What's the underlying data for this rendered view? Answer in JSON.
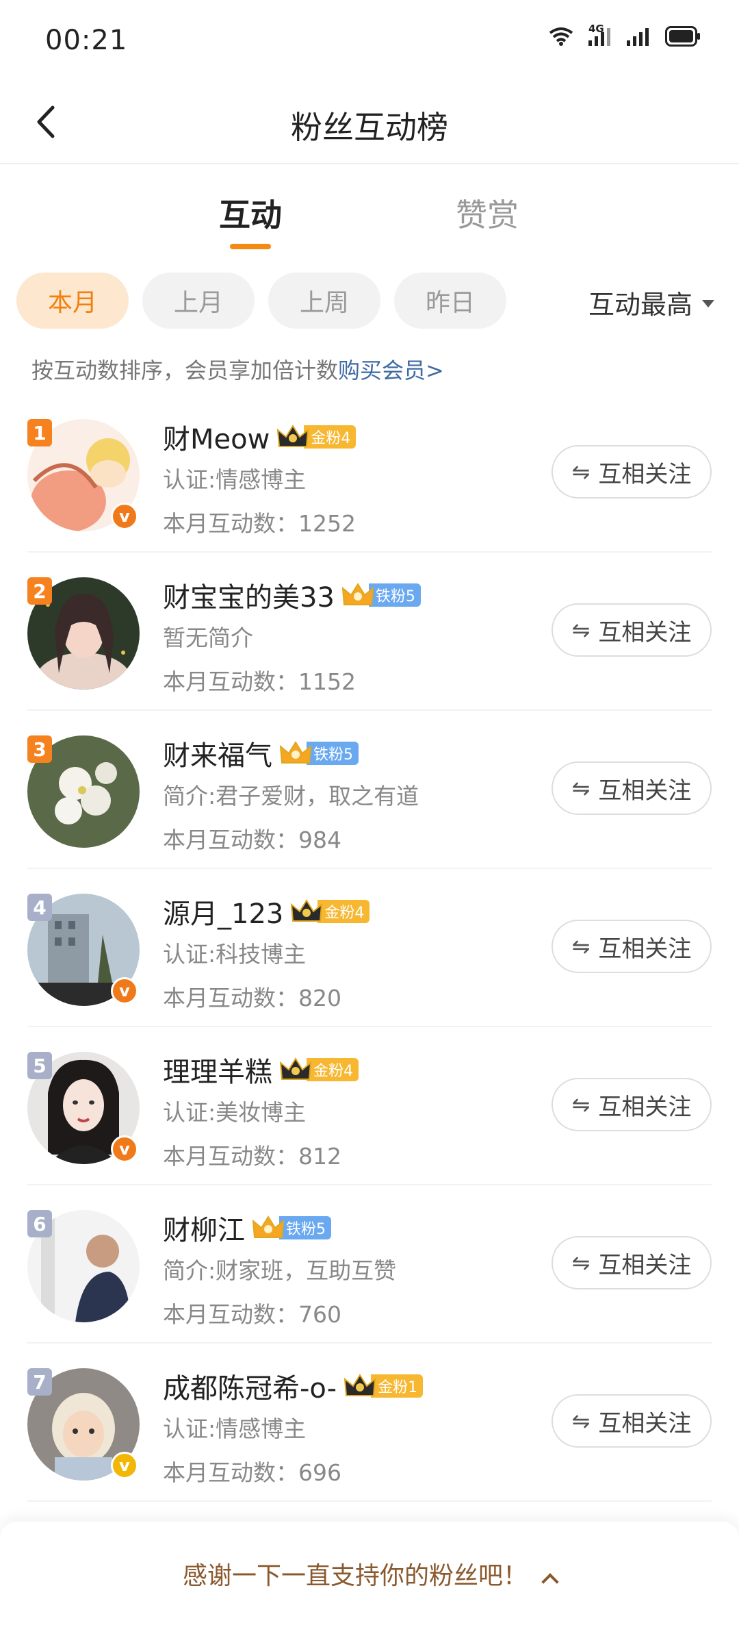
{
  "status_bar": {
    "time": "00:21",
    "network": "4G"
  },
  "header": {
    "title": "粉丝互动榜"
  },
  "tabs": [
    {
      "label": "互动",
      "active": true
    },
    {
      "label": "赞赏",
      "active": false
    }
  ],
  "filters": {
    "chips": [
      {
        "label": "本月",
        "active": true
      },
      {
        "label": "上月",
        "active": false
      },
      {
        "label": "上周",
        "active": false
      },
      {
        "label": "昨日",
        "active": false
      }
    ],
    "sort_label": "互动最高"
  },
  "hint": {
    "text": "按互动数排序，会员享加倍计数",
    "link": "购买会员>"
  },
  "follow_label": "互相关注",
  "rows": [
    {
      "rank": "1",
      "name": "财Meow",
      "badge": "金粉4",
      "badge_type": "gold",
      "desc": "认证:情感博主",
      "count": "本月互动数：1252",
      "verified": "orange"
    },
    {
      "rank": "2",
      "name": "财宝宝的美33",
      "badge": "铁粉5",
      "badge_type": "iron",
      "desc": "暂无简介",
      "count": "本月互动数：1152",
      "verified": ""
    },
    {
      "rank": "3",
      "name": "财来福气",
      "badge": "铁粉5",
      "badge_type": "iron",
      "desc": "简介:君子爱财，取之有道",
      "count": "本月互动数：984",
      "verified": ""
    },
    {
      "rank": "4",
      "name": "源月_123",
      "badge": "金粉4",
      "badge_type": "gold",
      "desc": "认证:科技博主",
      "count": "本月互动数：820",
      "verified": "orange"
    },
    {
      "rank": "5",
      "name": "理理羊糕",
      "badge": "金粉4",
      "badge_type": "gold",
      "desc": "认证:美妆博主",
      "count": "本月互动数：812",
      "verified": "orange"
    },
    {
      "rank": "6",
      "name": "财柳江",
      "badge": "铁粉5",
      "badge_type": "iron",
      "desc": "简介:财家班，互助互赞",
      "count": "本月互动数：760",
      "verified": ""
    },
    {
      "rank": "7",
      "name": "成都陈冠希-o-",
      "badge": "金粉1",
      "badge_type": "gold",
      "desc": "认证:情感博主",
      "count": "本月互动数：696",
      "verified": "yellow"
    }
  ],
  "bottom_bar": {
    "text": "感谢一下一直支持你的粉丝吧！"
  },
  "colors": {
    "accent": "#f58a12",
    "rank_top3": "#f5811f",
    "rank_other": "#a7b0c8",
    "gold_badge": "#f7b731",
    "iron_badge": "#6aa9f0",
    "link": "#3d6aa3"
  }
}
